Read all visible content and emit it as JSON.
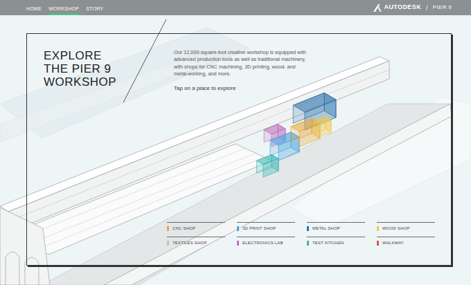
{
  "nav": {
    "items": [
      {
        "label": "HOME",
        "selected": false
      },
      {
        "label": "WORKSHOP",
        "selected": true
      },
      {
        "label": "STORY",
        "selected": false
      }
    ],
    "brand": "AUTODESK",
    "separator": "/",
    "site": "PIER 9"
  },
  "intro": {
    "title": [
      "EXPLORE",
      "THE PIER 9",
      "WORKSHOP"
    ],
    "body": "Our 12,000-square-foot creative workshop is equipped with advanced production tools as well as traditional machinery, with shops for CNC machining, 3D printing, wood- and metal-working, and more.",
    "prompt": "Tap on a place to explore"
  },
  "legend": [
    {
      "label": "CNC SHOP",
      "color": "#e8a93a"
    },
    {
      "label": "3D PRINT SHOP",
      "color": "#4aa3df"
    },
    {
      "label": "METAL SHOP",
      "color": "#2a6fa8"
    },
    {
      "label": "WOOD SHOP",
      "color": "#f0c84a"
    },
    {
      "label": "TEXTILES SHOP",
      "color": "#bfbfbf"
    },
    {
      "label": "ELECTRONICS LAB",
      "color": "#c06fc0"
    },
    {
      "label": "TEST KITCHEN",
      "color": "#3ab8b2"
    },
    {
      "label": "WALKWAY",
      "color": "#d9534f"
    }
  ]
}
